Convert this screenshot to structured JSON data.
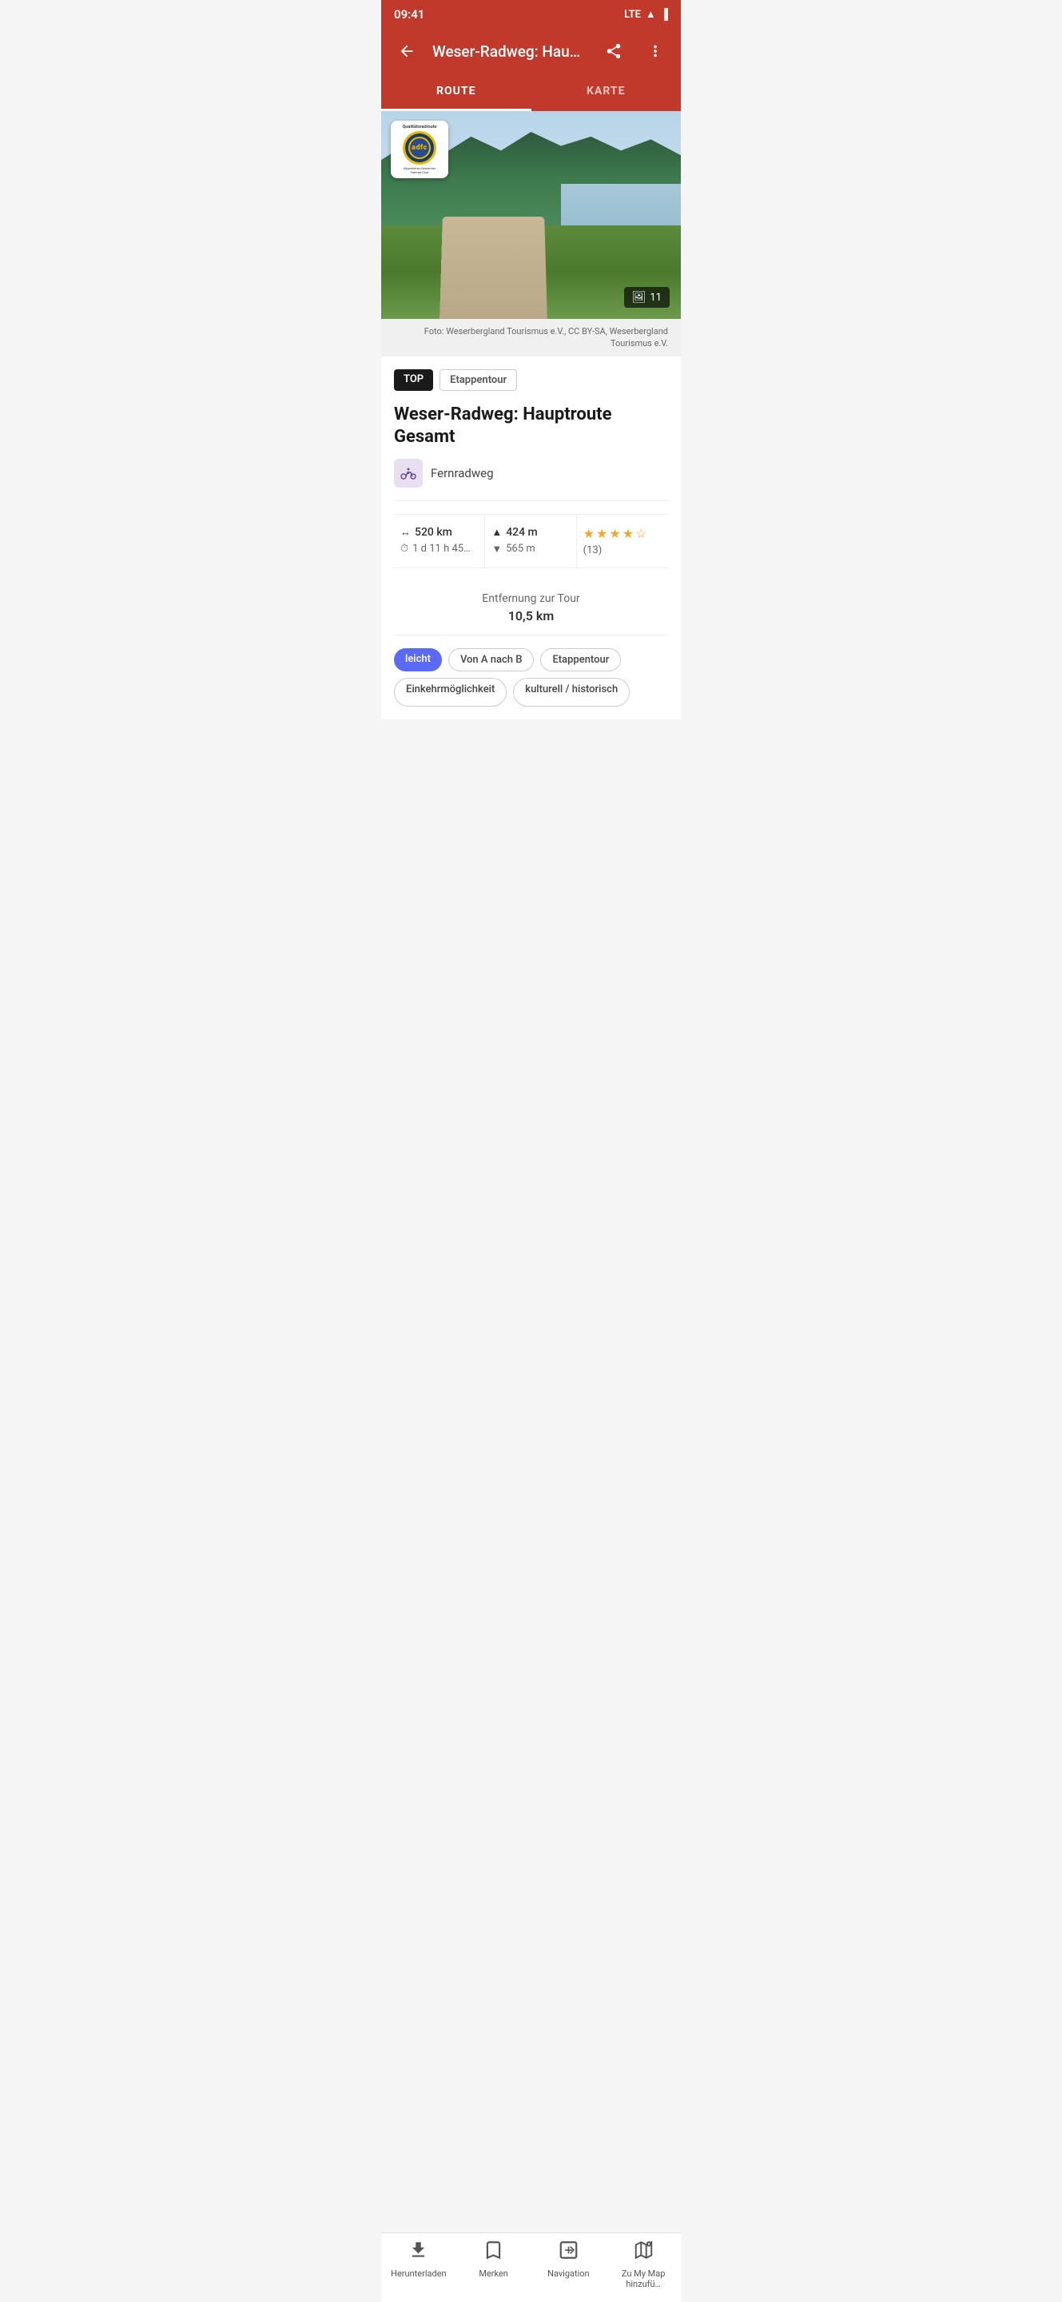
{
  "status_bar": {
    "time": "09:41",
    "signal": "LTE",
    "battery_icon": "🔋"
  },
  "app_bar": {
    "title": "Weser-Radweg: Hauptrou...",
    "back_icon": "←",
    "share_icon": "⤴",
    "more_icon": "⋮"
  },
  "tabs": [
    {
      "id": "route",
      "label": "ROUTE",
      "active": true
    },
    {
      "id": "karte",
      "label": "KARTE",
      "active": false
    }
  ],
  "hero": {
    "photo_count": "11",
    "photo_credit": "Foto: Weserbergland Tourismus e.V., CC BY-SA, Weserbergland Tourismus e.V."
  },
  "adfc_badge": {
    "top_text": "Qualitätsradroute",
    "logo_text": "adfc",
    "sub_text": "Allgemeiner Deutscher\nFahrrad-Club"
  },
  "tags": [
    {
      "id": "top",
      "label": "TOP",
      "style": "top"
    },
    {
      "id": "etappentour",
      "label": "Etappentour",
      "style": "outline"
    }
  ],
  "route": {
    "title": "Weser-Radweg: Hauptroute Gesamt",
    "type": "Fernradweg",
    "distance": "520 km",
    "duration": "1 d 11 h 45…",
    "elevation_up": "424 m",
    "elevation_down": "565 m",
    "rating_stars": 4.5,
    "rating_count": "(13)",
    "distance_to_tour_label": "Entfernung zur Tour",
    "distance_to_tour_value": "10,5 km"
  },
  "filter_tags": [
    {
      "id": "leicht",
      "label": "leicht",
      "style": "filled"
    },
    {
      "id": "von-a-nach-b",
      "label": "Von A nach B",
      "style": "outline"
    },
    {
      "id": "etappentour2",
      "label": "Etappentour",
      "style": "outline"
    }
  ],
  "more_tags": [
    {
      "id": "einkehr",
      "label": "Einkehrmöglichkeit"
    },
    {
      "id": "kulturell",
      "label": "kulturell / historisch"
    }
  ],
  "bottom_nav": [
    {
      "id": "herunterladen",
      "icon": "⬇",
      "label": "Herunterladen",
      "active": false
    },
    {
      "id": "merken",
      "icon": "🔖",
      "label": "Merken",
      "active": false
    },
    {
      "id": "navigation",
      "icon": "➤",
      "label": "Navigation",
      "active": false
    },
    {
      "id": "my-map",
      "icon": "🗺",
      "label": "Zu My Map hinzufü…",
      "active": false
    }
  ]
}
